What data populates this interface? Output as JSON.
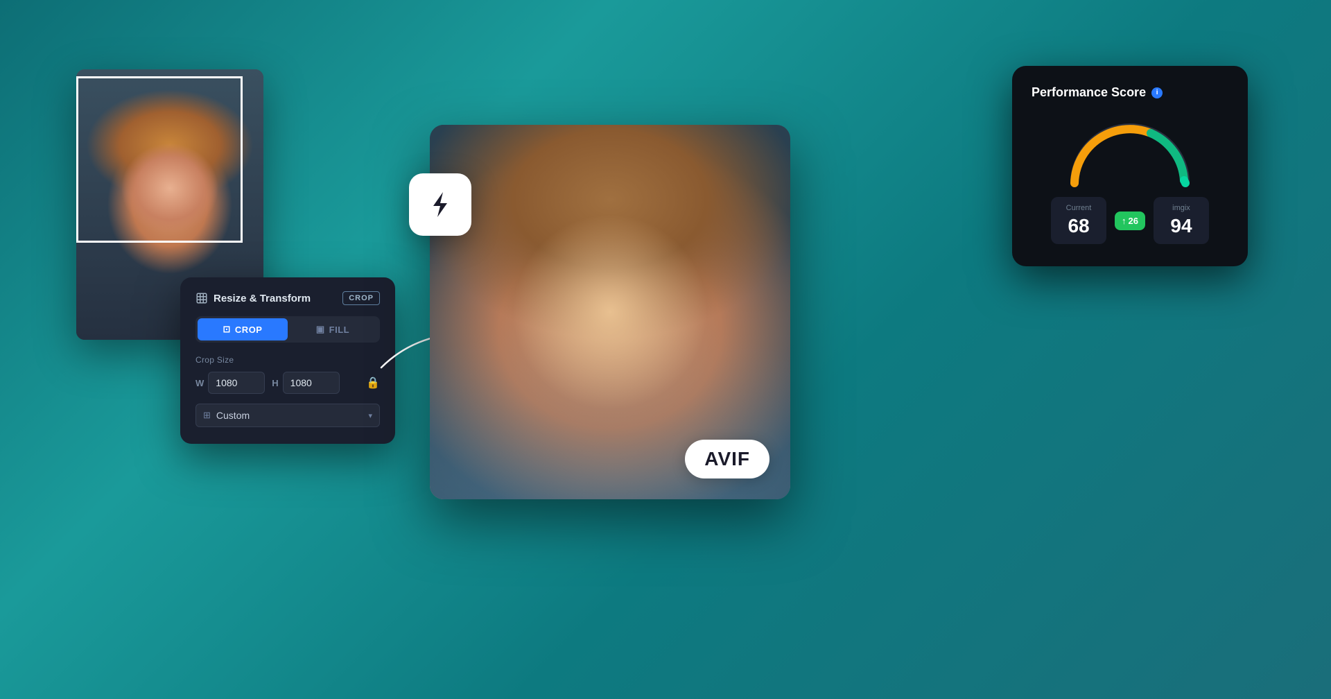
{
  "scene": {
    "background": "teal gradient"
  },
  "resize_panel": {
    "title": "Resize & Transform",
    "badge": "CROP",
    "tab_crop": "CROP",
    "tab_fill": "FILL",
    "section_label": "Crop Size",
    "width_label": "W",
    "width_value": "1080",
    "height_label": "H",
    "height_value": "1080",
    "dropdown_value": "Custom"
  },
  "avif_badge": {
    "text": "AVIF"
  },
  "perf_panel": {
    "title": "Performance Score",
    "current_label": "Current",
    "current_value": "68",
    "imgix_label": "imgix",
    "imgix_value": "94",
    "improvement": "26"
  }
}
